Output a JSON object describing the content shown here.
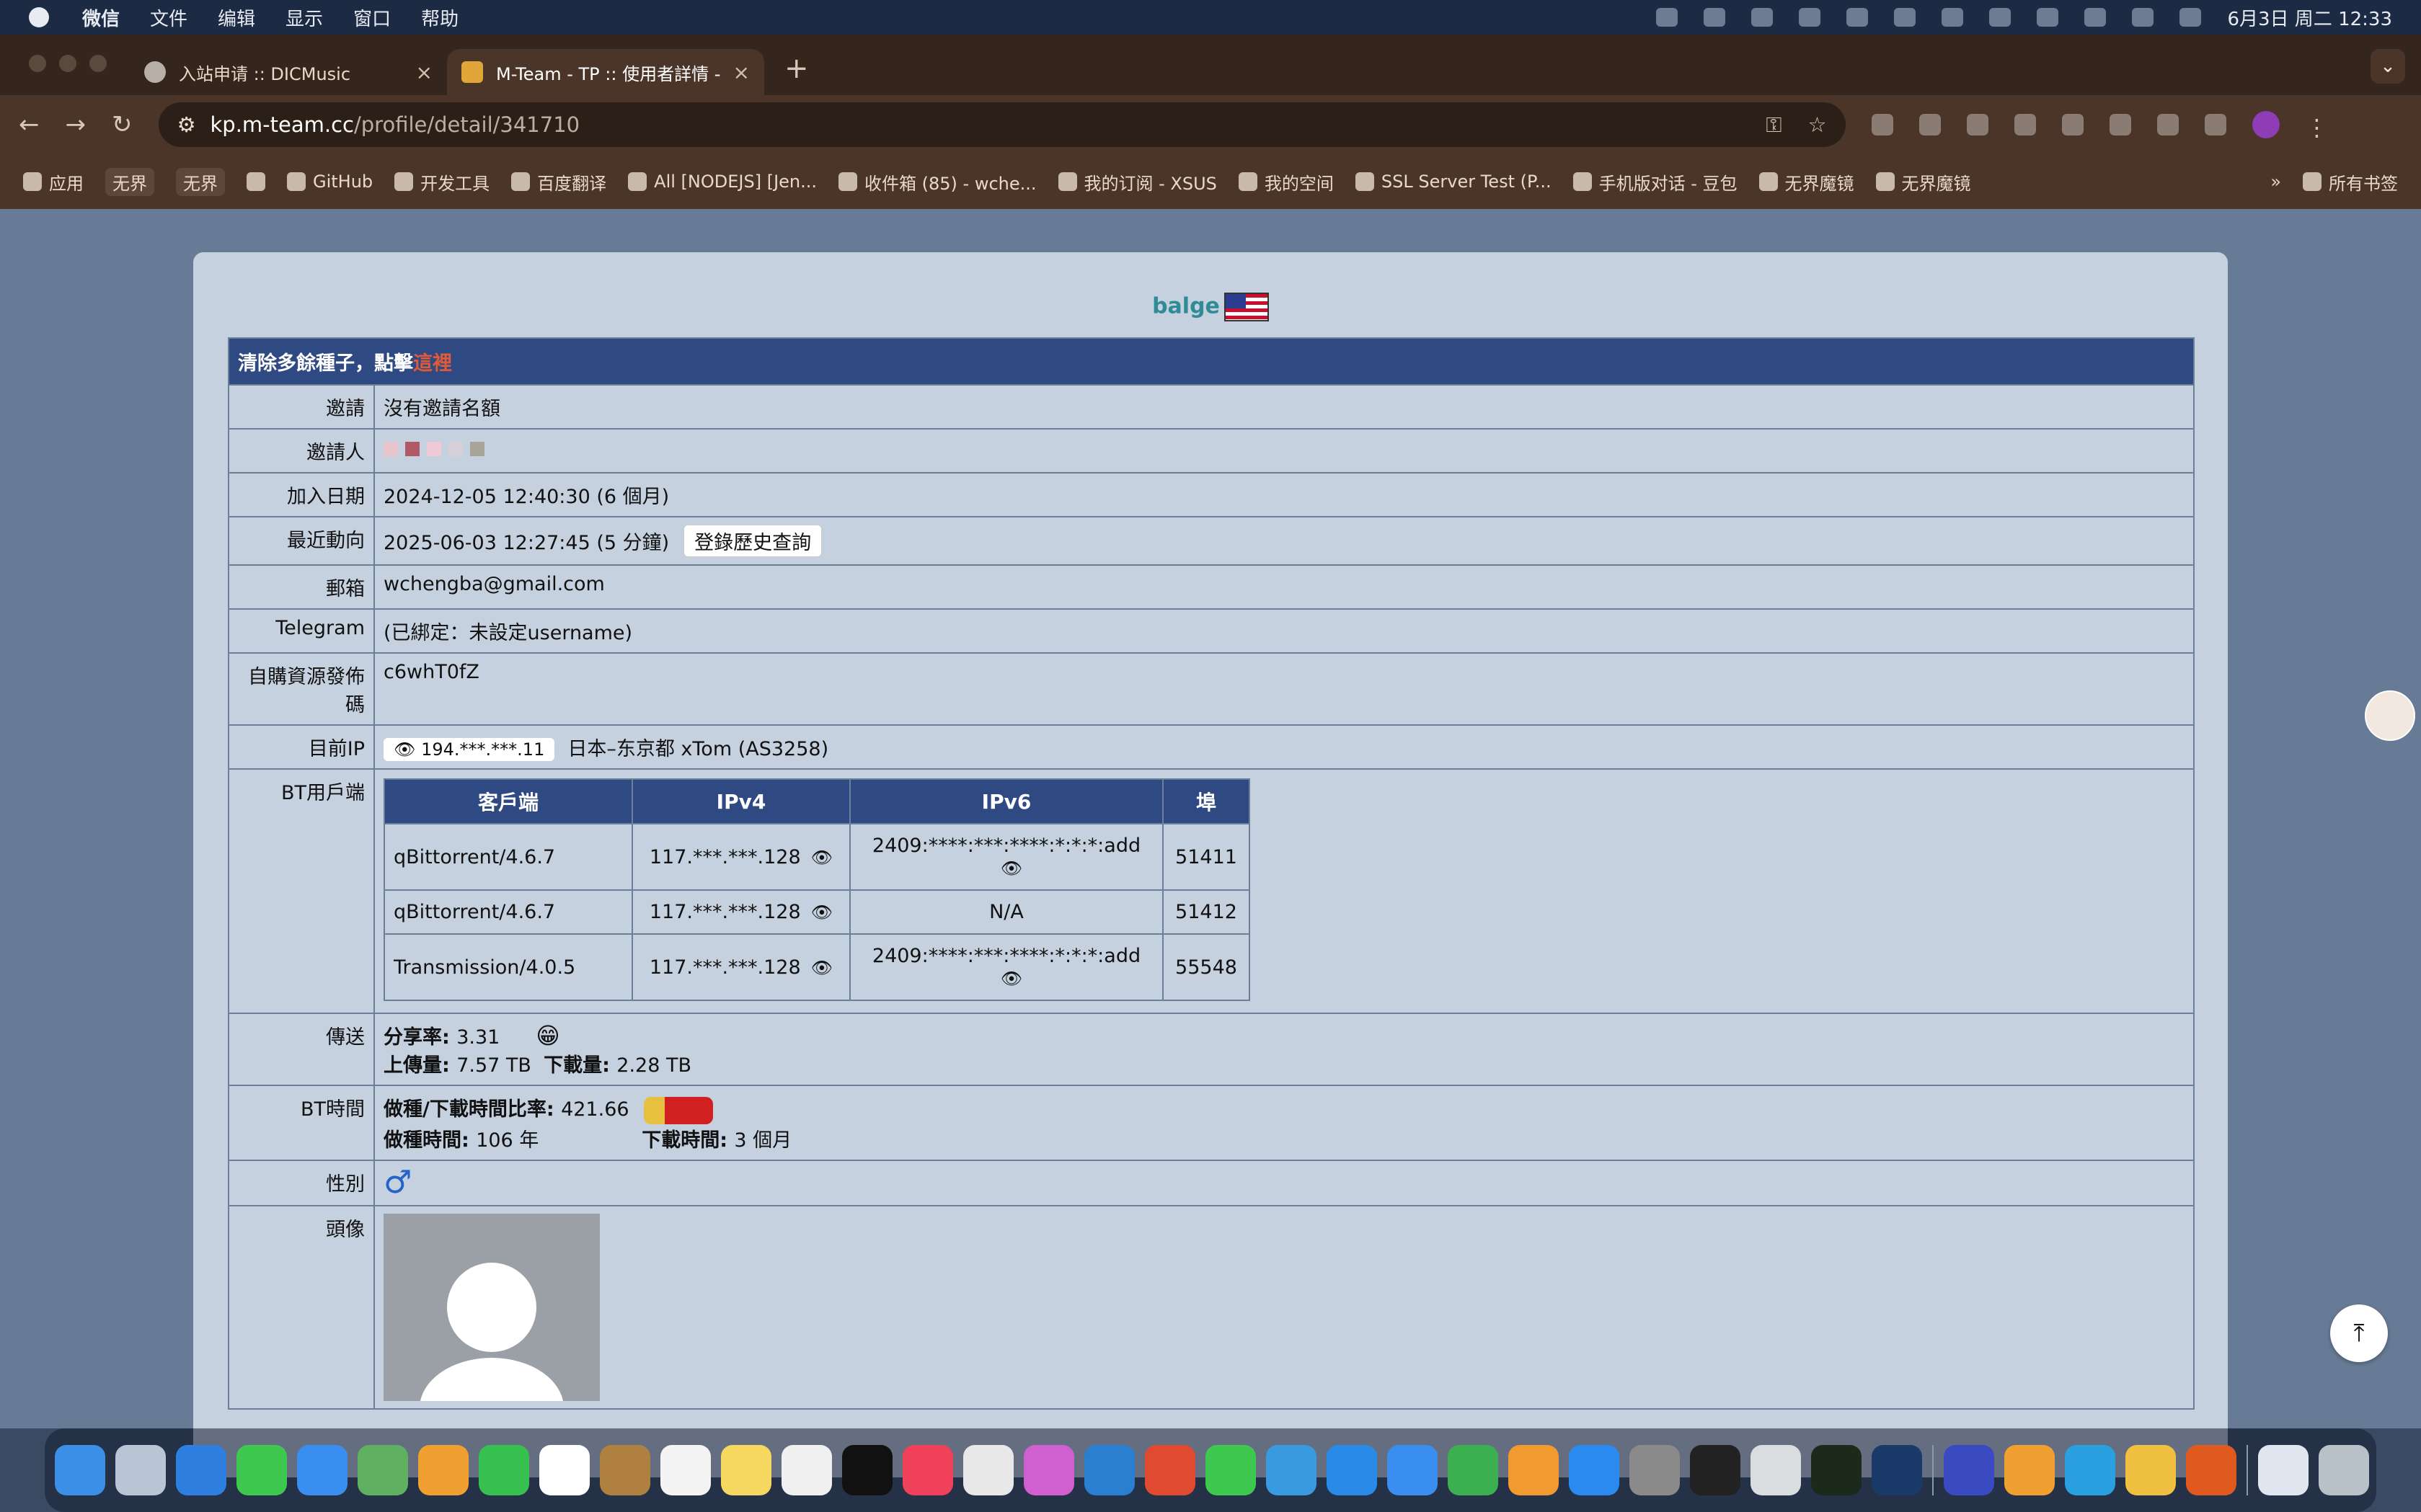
{
  "menubar": {
    "app": "微信",
    "items": [
      "文件",
      "编辑",
      "显示",
      "窗口",
      "帮助"
    ],
    "clock": "6月3日 周二 12:33"
  },
  "tabs": [
    {
      "title": "入站申请 :: DICMusic"
    },
    {
      "title": "M-Team - TP :: 使用者詳情 - P"
    }
  ],
  "address": {
    "host": "kp.m-team.cc",
    "path": "/profile/detail/341710"
  },
  "bookmarks": [
    {
      "label": "应用"
    },
    {
      "label": "无界"
    },
    {
      "label": "无界"
    },
    {
      "label": "GitHub"
    },
    {
      "label": "开发工具"
    },
    {
      "label": "百度翻译"
    },
    {
      "label": "All [NODEJS] [Jen..."
    },
    {
      "label": "收件箱 (85) - wche..."
    },
    {
      "label": "我的订阅 - XSUS"
    },
    {
      "label": "我的空间"
    },
    {
      "label": "SSL Server Test (P..."
    },
    {
      "label": "手机版对话 - 豆包"
    },
    {
      "label": "无界魔镜"
    },
    {
      "label": "无界魔镜"
    }
  ],
  "all_bookmarks": "所有书签",
  "profile": {
    "username": "balge",
    "banner_text": "清除多餘種子，點擊",
    "banner_link": "這裡",
    "labels": {
      "invite": "邀請",
      "inviter": "邀請人",
      "join_date": "加入日期",
      "last_seen": "最近動向",
      "email": "郵箱",
      "telegram": "Telegram",
      "passkey": "自購資源發佈碼",
      "ip": "目前IP",
      "bt_client": "BT用戶端",
      "transfer": "傳送",
      "bt_time": "BT時間",
      "gender": "性別",
      "avatar": "頭像"
    },
    "invite_value": "沒有邀請名額",
    "join_date_value": "2024-12-05 12:40:30 (6 個月)",
    "last_seen_value": "2025-06-03 12:27:45 (5 分鐘)",
    "login_history_button": "登錄歷史查詢",
    "email_value": "wchengba@gmail.com",
    "telegram_value": "(已綁定：未設定username)",
    "passkey_value": "c6whT0fZ",
    "ip_value": "194.***.***.11",
    "ip_location": "日本–东京都 xTom (AS3258)",
    "clients": {
      "headers": [
        "客戶端",
        "IPv4",
        "IPv6",
        "埠"
      ],
      "rows": [
        {
          "client": "qBittorrent/4.6.7",
          "ipv4": "117.***.***.128",
          "ipv6": "2409:****:***:****:*:*:*:add",
          "port": "51411"
        },
        {
          "client": "qBittorrent/4.6.7",
          "ipv4": "117.***.***.128",
          "ipv6": "N/A",
          "port": "51412"
        },
        {
          "client": "Transmission/4.0.5",
          "ipv4": "117.***.***.128",
          "ipv6": "2409:****:***:****:*:*:*:add",
          "port": "55548"
        }
      ]
    },
    "transfer": {
      "ratio_label": "分享率",
      "ratio_value": "3.31",
      "upload_label": "上傳量",
      "upload_value": "7.57 TB",
      "download_label": "下載量",
      "download_value": "2.28 TB"
    },
    "bt_time": {
      "ratio_label": "做種/下載時間比率",
      "ratio_value": "421.66",
      "seed_label": "做種時間",
      "seed_value": "106 年",
      "dl_label": "下載時間",
      "dl_value": "3 個月"
    },
    "gender_symbol": "♂"
  },
  "colors": {
    "header_bg": "#2f4a82",
    "link_red": "#e05a3a",
    "username": "#2f8b95"
  }
}
